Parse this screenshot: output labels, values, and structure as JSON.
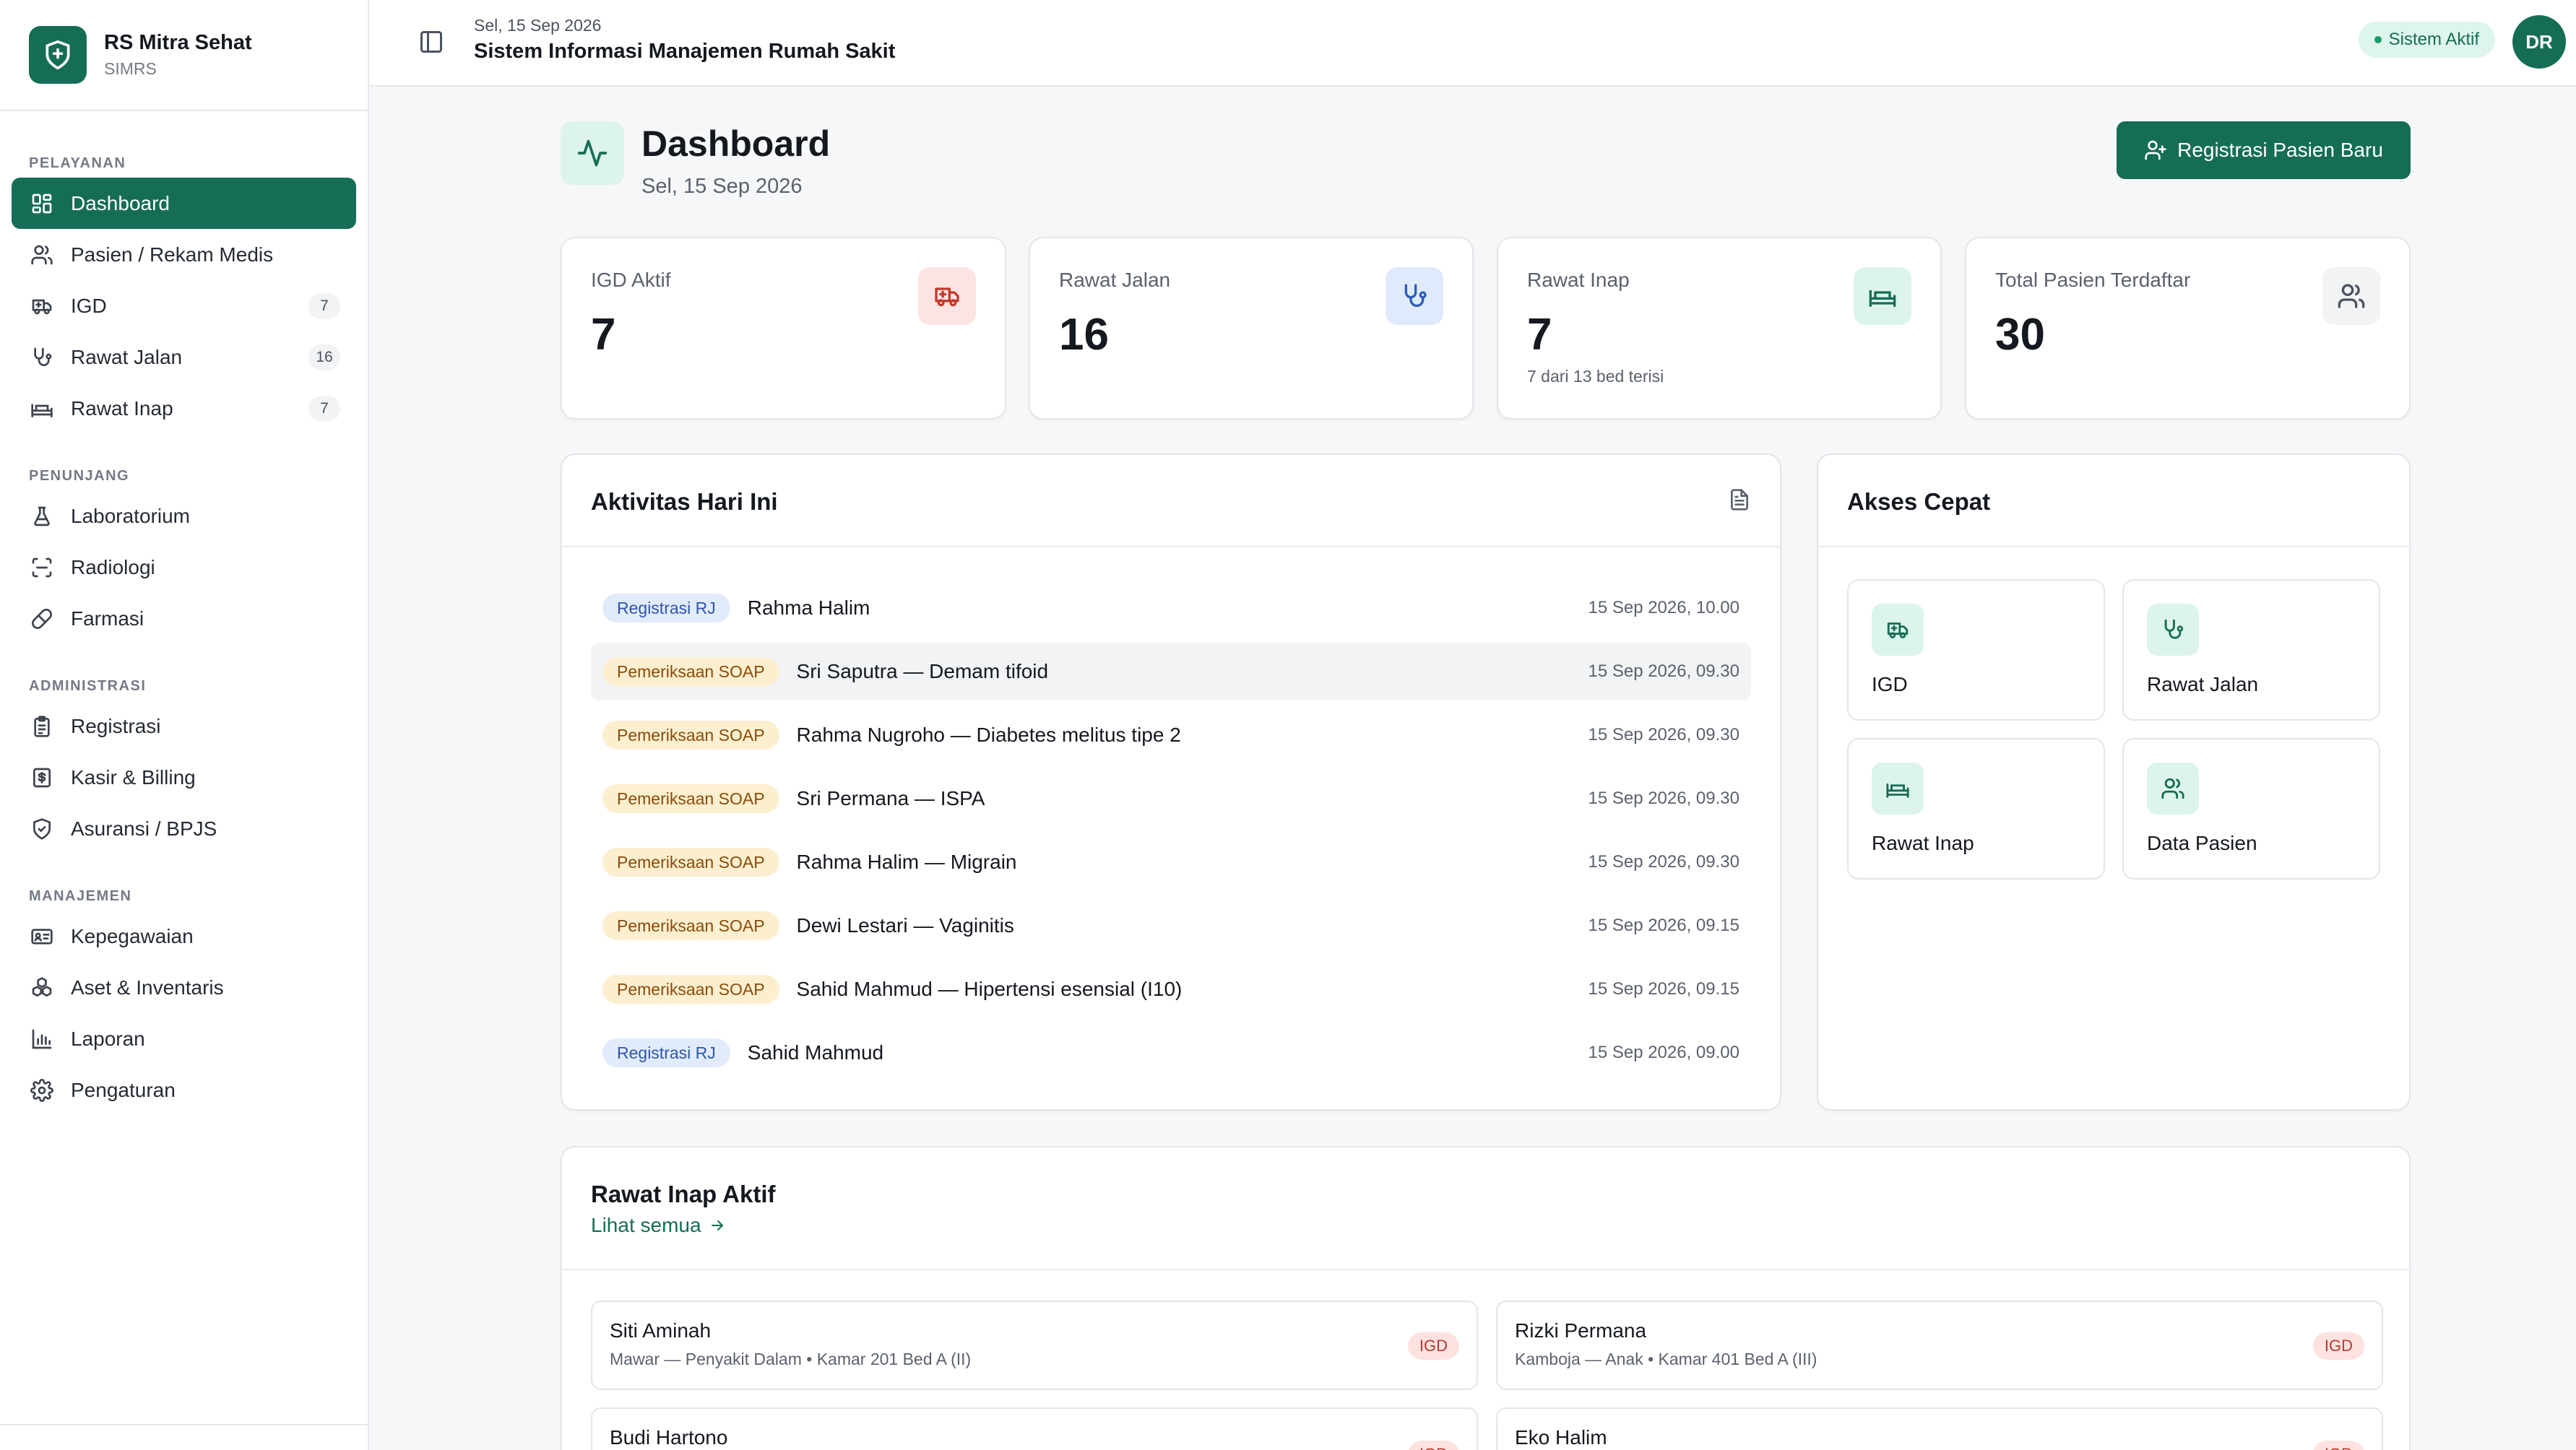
{
  "brand": {
    "name": "RS Mitra Sehat",
    "sub": "SIMRS"
  },
  "sidebar": {
    "sections": [
      {
        "title": "PELAYANAN",
        "items": [
          {
            "label": "Dashboard",
            "icon": "dashboard-icon",
            "active": true
          },
          {
            "label": "Pasien / Rekam Medis",
            "icon": "users-icon"
          },
          {
            "label": "IGD",
            "icon": "ambulance-icon",
            "count": "7"
          },
          {
            "label": "Rawat Jalan",
            "icon": "stethoscope-icon",
            "count": "16"
          },
          {
            "label": "Rawat Inap",
            "icon": "bed-icon",
            "count": "7"
          }
        ]
      },
      {
        "title": "PENUNJANG",
        "items": [
          {
            "label": "Laboratorium",
            "icon": "flask-icon"
          },
          {
            "label": "Radiologi",
            "icon": "scan-icon"
          },
          {
            "label": "Farmasi",
            "icon": "pill-icon"
          }
        ]
      },
      {
        "title": "ADMINISTRASI",
        "items": [
          {
            "label": "Registrasi",
            "icon": "clipboard-icon"
          },
          {
            "label": "Kasir & Billing",
            "icon": "receipt-icon"
          },
          {
            "label": "Asuransi / BPJS",
            "icon": "shield-check-icon"
          }
        ]
      },
      {
        "title": "MANAJEMEN",
        "items": [
          {
            "label": "Kepegawaian",
            "icon": "id-card-icon"
          },
          {
            "label": "Aset & Inventaris",
            "icon": "boxes-icon"
          },
          {
            "label": "Laporan",
            "icon": "bar-chart-icon"
          },
          {
            "label": "Pengaturan",
            "icon": "gear-icon"
          }
        ]
      }
    ]
  },
  "header": {
    "date": "Sel, 15 Sep 2026",
    "title": "Sistem Informasi Manajemen Rumah Sakit",
    "status": "Sistem Aktif",
    "avatar": "DR"
  },
  "page": {
    "title": "Dashboard",
    "date": "Sel, 15 Sep 2026",
    "primary_button": "Registrasi Pasien Baru"
  },
  "stats": [
    {
      "label": "IGD Aktif",
      "value": "7",
      "sub": "",
      "icon": "ambulance-icon",
      "bg": "#fde4e2",
      "fg": "#c0392b"
    },
    {
      "label": "Rawat Jalan",
      "value": "16",
      "sub": "",
      "icon": "stethoscope-icon",
      "bg": "#dfeafc",
      "fg": "#2e5cb8"
    },
    {
      "label": "Rawat Inap",
      "value": "7",
      "sub": "7 dari 13 bed terisi",
      "icon": "bed-icon",
      "bg": "#dcf4ec",
      "fg": "#166d55"
    },
    {
      "label": "Total Pasien Terdaftar",
      "value": "30",
      "sub": "",
      "icon": "users-icon",
      "bg": "#f1f3f5",
      "fg": "#4b5260"
    }
  ],
  "activity": {
    "title": "Aktivitas Hari Ini",
    "items": [
      {
        "type": "Registrasi RJ",
        "kind": "rj",
        "text": "Rahma Halim",
        "time": "15 Sep 2026, 10.00"
      },
      {
        "type": "Pemeriksaan SOAP",
        "kind": "soap",
        "text": "Sri Saputra — Demam tifoid",
        "time": "15 Sep 2026, 09.30"
      },
      {
        "type": "Pemeriksaan SOAP",
        "kind": "soap",
        "text": "Rahma Nugroho — Diabetes melitus tipe 2",
        "time": "15 Sep 2026, 09.30"
      },
      {
        "type": "Pemeriksaan SOAP",
        "kind": "soap",
        "text": "Sri Permana — ISPA",
        "time": "15 Sep 2026, 09.30"
      },
      {
        "type": "Pemeriksaan SOAP",
        "kind": "soap",
        "text": "Rahma Halim — Migrain",
        "time": "15 Sep 2026, 09.30"
      },
      {
        "type": "Pemeriksaan SOAP",
        "kind": "soap",
        "text": "Dewi Lestari — Vaginitis",
        "time": "15 Sep 2026, 09.15"
      },
      {
        "type": "Pemeriksaan SOAP",
        "kind": "soap",
        "text": "Sahid Mahmud — Hipertensi esensial (I10)",
        "time": "15 Sep 2026, 09.15"
      },
      {
        "type": "Registrasi RJ",
        "kind": "rj",
        "text": "Sahid Mahmud",
        "time": "15 Sep 2026, 09.00"
      }
    ]
  },
  "quick": {
    "title": "Akses Cepat",
    "items": [
      {
        "label": "IGD",
        "icon": "ambulance-icon"
      },
      {
        "label": "Rawat Jalan",
        "icon": "stethoscope-icon"
      },
      {
        "label": "Rawat Inap",
        "icon": "bed-icon"
      },
      {
        "label": "Data Pasien",
        "icon": "users-icon"
      }
    ]
  },
  "inpatient": {
    "title": "Rawat Inap Aktif",
    "link": "Lihat semua",
    "patients": [
      {
        "name": "Siti Aminah",
        "meta": "Mawar — Penyakit Dalam • Kamar 201 Bed A (II)",
        "tag": "IGD"
      },
      {
        "name": "Rizki Permana",
        "meta": "Kamboja — Anak • Kamar 401 Bed A (III)",
        "tag": "IGD"
      },
      {
        "name": "Budi Hartono",
        "meta": "",
        "tag": "IGD"
      },
      {
        "name": "Eko Halim",
        "meta": "",
        "tag": "IGD"
      }
    ]
  }
}
